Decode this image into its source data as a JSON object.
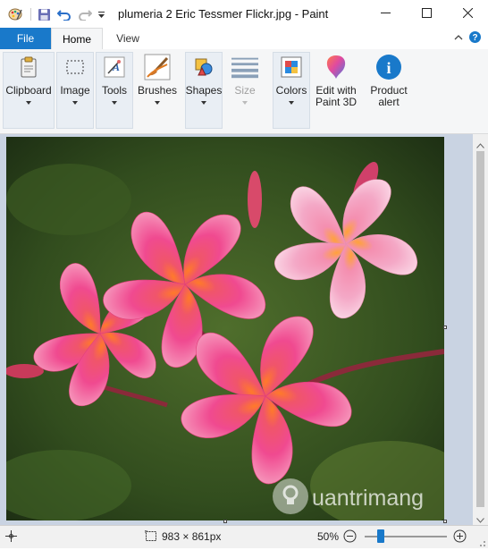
{
  "window": {
    "title": "plumeria 2 Eric Tessmer Flickr.jpg - Paint",
    "controls": {
      "minimize": "minimize-icon",
      "maximize": "maximize-icon",
      "close": "close-icon"
    }
  },
  "quick_access": [
    "paint-app-icon",
    "save-icon",
    "undo-icon",
    "redo-icon",
    "customize-dropdown-icon"
  ],
  "tabs": {
    "file": "File",
    "home": "Home",
    "view": "View"
  },
  "ribbon": {
    "clipboard": "Clipboard",
    "image": "Image",
    "tools": "Tools",
    "brushes": "Brushes",
    "shapes": "Shapes",
    "size": "Size",
    "colors": "Colors",
    "edit_paint3d_line1": "Edit with",
    "edit_paint3d_line2": "Paint 3D",
    "product_alert_line1": "Product",
    "product_alert_line2": "alert"
  },
  "canvas": {
    "watermark": "uantrimang"
  },
  "status": {
    "dimensions": "983 × 861px",
    "zoom": "50%",
    "zoom_slider_fraction": 0.5
  },
  "colors": {
    "file_tab": "#1979ca",
    "accent": "#1979ca"
  }
}
